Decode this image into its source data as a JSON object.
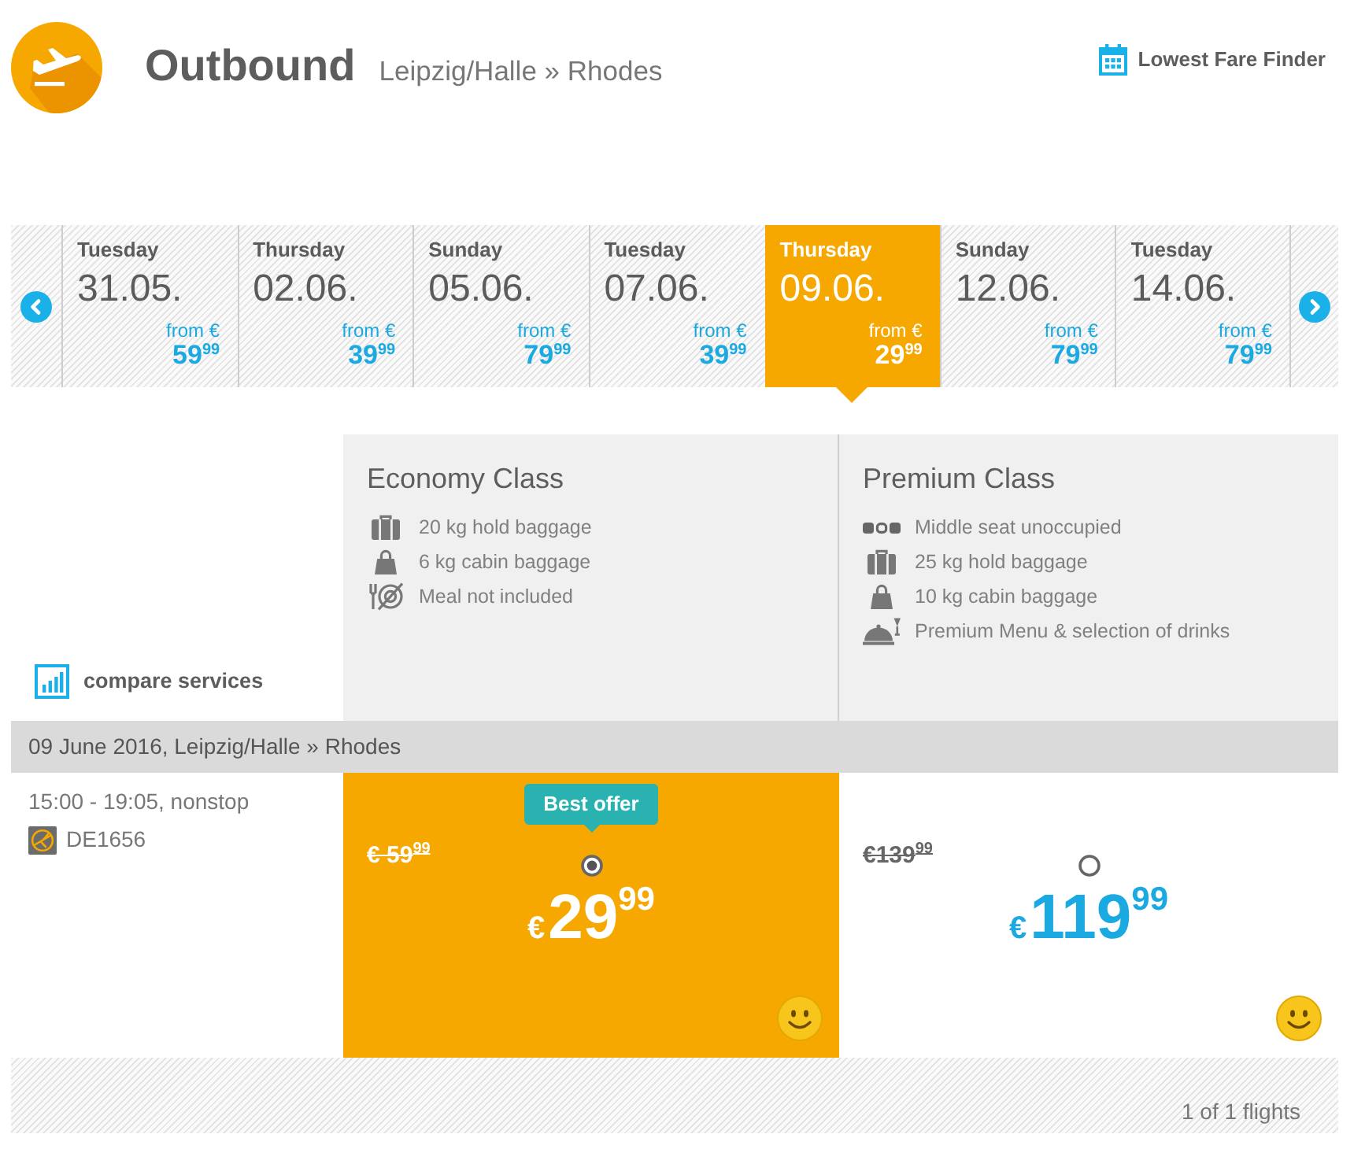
{
  "header": {
    "title": "Outbound",
    "route": "Leipzig/Halle » Rhodes",
    "fare_finder_link": "Lowest Fare Finder"
  },
  "date_strip": {
    "dates": [
      {
        "weekday": "Tuesday",
        "date": "31.05.",
        "from_label": "from €",
        "price": "59$^{99}$",
        "selected": false
      },
      {
        "weekday": "Thursday",
        "date": "02.06.",
        "from_label": "from €",
        "price": "39$^{99}$",
        "selected": false
      },
      {
        "weekday": "Sunday",
        "date": "05.06.",
        "from_label": "from €",
        "price": "79$^{99}$",
        "selected": false
      },
      {
        "weekday": "Tuesday",
        "date": "07.06.",
        "from_label": "from €",
        "price": "39$^{99}$",
        "selected": false
      },
      {
        "weekday": "Thursday",
        "date": "09.06.",
        "from_label": "from €",
        "price": "29$^{99}$",
        "selected": true
      },
      {
        "weekday": "Sunday",
        "date": "12.06.",
        "from_label": "from €",
        "price": "79$^{99}$",
        "selected": false
      },
      {
        "weekday": "Tuesday",
        "date": "14.06.",
        "from_label": "from €",
        "price": "79$^{99}$",
        "selected": false
      }
    ]
  },
  "services": {
    "compare_link": "compare services",
    "classes": [
      {
        "name": "Economy Class",
        "features": [
          {
            "kind": "hold-baggage",
            "text": "20 kg hold baggage"
          },
          {
            "kind": "cabin-baggage",
            "text": "6 kg cabin baggage"
          },
          {
            "kind": "no-meal",
            "text": "Meal not included"
          }
        ]
      },
      {
        "name": "Premium Class",
        "features": [
          {
            "kind": "free-middle-seat",
            "text": "Middle seat unoccupied"
          },
          {
            "kind": "hold-baggage",
            "text": "25 kg hold baggage"
          },
          {
            "kind": "cabin-baggage",
            "text": "10 kg cabin baggage"
          },
          {
            "kind": "premium-meal",
            "text": "Premium Menu & selection of drinks"
          }
        ]
      }
    ]
  },
  "flight_date_bar": {
    "text": "09 June 2016, Leipzig/Halle » Rhodes"
  },
  "flights": [
    {
      "times": "15:00 - 19:05, nonstop",
      "flight_number": "DE1656",
      "fares": [
        {
          "badge": "Best offer",
          "old_price": "€ 59$^{99}$",
          "currency": "€",
          "price": "29$^{99}$",
          "selected": true
        },
        {
          "old_price": "€139$^{99}$",
          "currency": "€",
          "price": "119$^{99}$",
          "selected": false
        }
      ]
    }
  ],
  "footer": {
    "count": "1 of 1 flights"
  }
}
